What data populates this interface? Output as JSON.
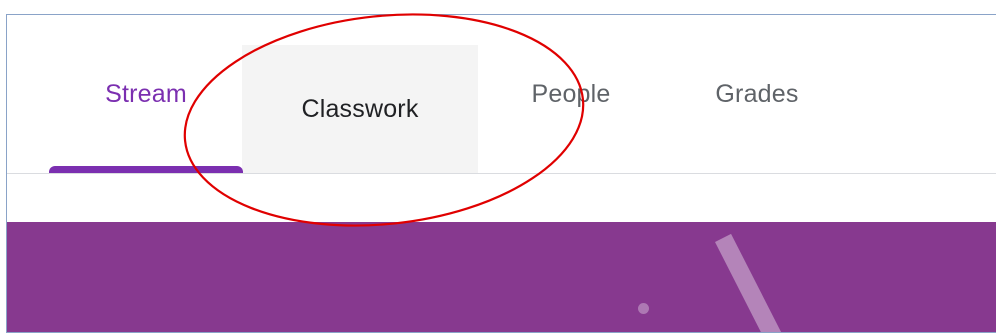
{
  "tabs": [
    {
      "label": "Stream",
      "active": true
    },
    {
      "label": "Classwork",
      "active": false
    },
    {
      "label": "People",
      "active": false
    },
    {
      "label": "Grades",
      "active": false
    }
  ],
  "colors": {
    "accent": "#7b2fb0",
    "banner": "#87398f",
    "annotation": "#e00000"
  }
}
